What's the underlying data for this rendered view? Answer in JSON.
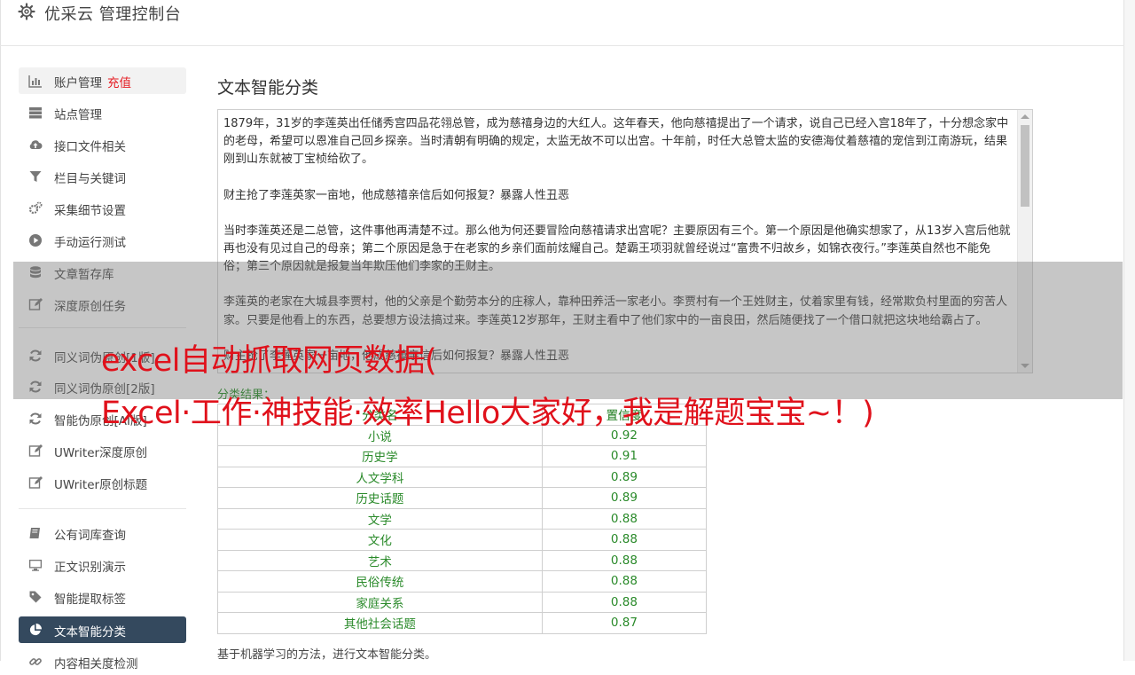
{
  "header": {
    "title": "优采云 管理控制台",
    "icon": "gear-icon"
  },
  "sidebar": {
    "items": [
      {
        "label": "账户管理",
        "tag": "充值",
        "icon": "bar-chart-icon"
      },
      {
        "label": "站点管理",
        "icon": "server-icon"
      },
      {
        "label": "接口文件相关",
        "icon": "cloud-upload-icon"
      },
      {
        "label": "栏目与关键词",
        "icon": "filter-icon"
      },
      {
        "label": "采集细节设置",
        "icon": "gears-icon"
      },
      {
        "label": "手动运行测试",
        "icon": "play-circle-icon"
      },
      {
        "label": "文章暂存库",
        "icon": "database-icon"
      },
      {
        "label": "深度原创任务",
        "icon": "edit-icon"
      },
      {
        "label": "同义词伪原创[1版]",
        "icon": "refresh-icon"
      },
      {
        "label": "同义词伪原创[2版]",
        "icon": "refresh-icon"
      },
      {
        "label": "智能伪原创[AI版]",
        "icon": "refresh-icon"
      },
      {
        "label": "UWriter深度原创",
        "icon": "edit-icon"
      },
      {
        "label": "UWriter原创标题",
        "icon": "edit-icon"
      },
      {
        "label": "公有词库查询",
        "icon": "book-icon"
      },
      {
        "label": "正文识别演示",
        "icon": "monitor-icon"
      },
      {
        "label": "智能提取标签",
        "icon": "tag-icon"
      },
      {
        "label": "文本智能分类",
        "icon": "pie-chart-icon"
      },
      {
        "label": "内容相关度检测",
        "icon": "link-icon"
      }
    ]
  },
  "main": {
    "title": "文本智能分类",
    "textarea_paragraphs": [
      "1879年，31岁的李莲英出任储秀宫四品花翎总管，成为慈禧身边的大红人。这年春天，他向慈禧提出了一个请求，说自己已经入宫18年了，十分想念家中的老母，希望可以恩准自己回乡探亲。当时清朝有明确的规定，太监无故不可以出宫。十年前，时任大总管太监的安德海仗着慈禧的宠信到江南游玩，结果刚到山东就被丁宝桢给砍了。",
      "财主抢了李莲英家一亩地，他成慈禧亲信后如何报复？暴露人性丑恶",
      "当时李莲英还是二总管，这件事他再清楚不过。那么他为何还要冒险向慈禧请求出宫呢？主要原因有三个。第一个原因是他确实想家了，从13岁入宫后他就再也没有见过自己的母亲；第二个原因是急于在老家的乡亲们面前炫耀自己。楚霸王项羽就曾经说过“富贵不归故乡，如锦衣夜行。”李莲英自然也不能免俗；第三个原因就是报复当年欺压他们李家的王财主。",
      "李莲英的老家在大城县李贾村，他的父亲是个勤劳本分的庄稼人，靠种田养活一家老小。李贾村有一个王姓财主，仗着家里有钱，经常欺负村里面的穷苦人家。只要是他看上的东西，总要想方设法搞过来。李莲英12岁那年，王财主看中了他们家中的一亩良田，然后随便找了一个借口就把这块地给霸占了。",
      "财主抢了李莲英家一亩地，他成慈禧亲信后如何报复？暴露人性丑恶"
    ],
    "result_label": "分类结果：",
    "table": {
      "headers": [
        "分类名",
        "置信度"
      ],
      "rows": [
        [
          "小说",
          "0.92"
        ],
        [
          "历史学",
          "0.91"
        ],
        [
          "人文学科",
          "0.89"
        ],
        [
          "历史话题",
          "0.89"
        ],
        [
          "文学",
          "0.88"
        ],
        [
          "文化",
          "0.88"
        ],
        [
          "艺术",
          "0.88"
        ],
        [
          "民俗传统",
          "0.88"
        ],
        [
          "家庭关系",
          "0.88"
        ],
        [
          "其他社会话题",
          "0.87"
        ]
      ]
    },
    "footer_note": "基于机器学习的方法，进行文本智能分类。"
  },
  "overlay": {
    "line1": "excel自动抓取网页数据(",
    "line2": "Excel·工作·神技能·效率Hello大家好，我是解题宝宝~！)"
  },
  "colors": {
    "active_nav": "#34495e",
    "accent_red": "#e51c23",
    "result_green": "#2a8a2a",
    "overlay_text": "#e0111b"
  }
}
